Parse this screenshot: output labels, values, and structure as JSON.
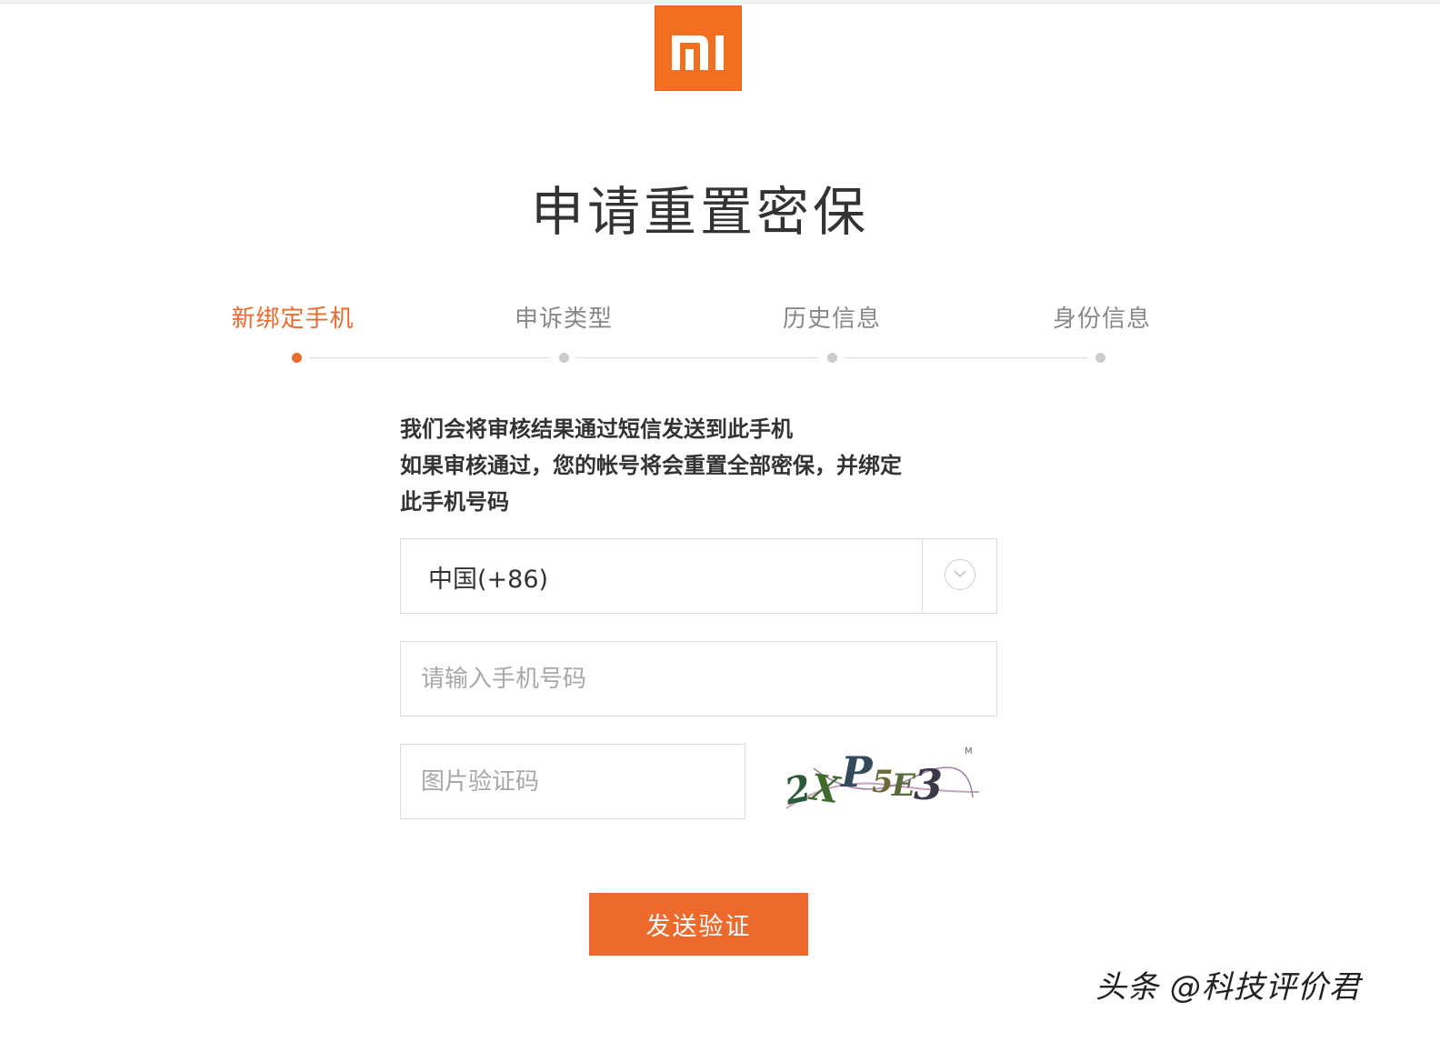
{
  "brand": {
    "logo_text": "MI",
    "accent": "#ed6a2c"
  },
  "title": "申请重置密保",
  "steps": [
    {
      "label": "新绑定手机",
      "active": true
    },
    {
      "label": "申诉类型",
      "active": false
    },
    {
      "label": "历史信息",
      "active": false
    },
    {
      "label": "身份信息",
      "active": false
    }
  ],
  "notice": {
    "line1": "我们会将审核结果通过短信发送到此手机",
    "line2": "如果审核通过，您的帐号将会重置全部密保，并绑定",
    "line3": "此手机号码"
  },
  "form": {
    "country_value": "中国(+86)",
    "country_icon": "chevron-down-circle-icon",
    "phone_placeholder": "请输入手机号码",
    "captcha_placeholder": "图片验证码",
    "captcha_image_text": "2XP5E3"
  },
  "submit_label": "发送验证",
  "watermark": "头条 @科技评价君"
}
